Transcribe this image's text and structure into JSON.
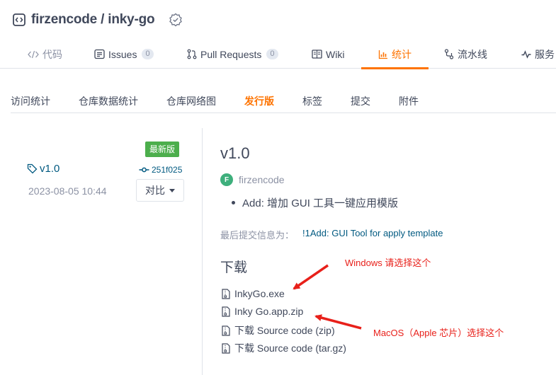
{
  "repo": {
    "title": "firzencode / inky-go"
  },
  "tabs": [
    {
      "label": "代码",
      "count": null
    },
    {
      "label": "Issues",
      "count": "0"
    },
    {
      "label": "Pull Requests",
      "count": "0"
    },
    {
      "label": "Wiki",
      "count": null
    },
    {
      "label": "统计",
      "count": null
    },
    {
      "label": "流水线",
      "count": null
    },
    {
      "label": "服务",
      "count": null
    }
  ],
  "subnav": [
    "访问统计",
    "仓库数据统计",
    "仓库网络图",
    "发行版",
    "标签",
    "提交",
    "附件"
  ],
  "release_meta": {
    "latest_badge": "最新版",
    "tag": "v1.0",
    "commit": "251f025",
    "date": "2023-08-05 10:44",
    "compare_label": "对比"
  },
  "release": {
    "title": "v1.0",
    "author_initial": "F",
    "author": "firzencode",
    "note": "Add: 增加 GUI 工具一键应用模版",
    "last_commit_label": "最后提交信息为：",
    "last_commit_link": "!1Add: GUI Tool for apply template",
    "download_heading": "下载",
    "assets": [
      "InkyGo.exe",
      "Inky Go.app.zip",
      "下载 Source code (zip)",
      "下载 Source code (tar.gz)"
    ]
  },
  "annotations": {
    "windows": "Windows 请选择这个",
    "macos": "MacOS（Apple 芯片）选择这个"
  },
  "colors": {
    "accent": "#fe7300",
    "link": "#005980",
    "latest_badge": "#4cae4c",
    "annotation": "#e8201a"
  }
}
